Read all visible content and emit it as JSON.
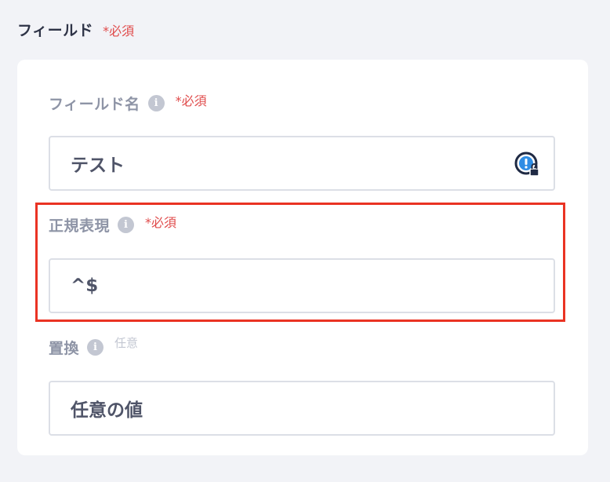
{
  "section": {
    "title": "フィールド",
    "required": "*必須"
  },
  "fields": [
    {
      "label": "フィールド名",
      "info": "i",
      "badge": "*必須",
      "value": "テスト"
    },
    {
      "label": "正規表現",
      "info": "i",
      "badge": "*必須",
      "value": "^$"
    },
    {
      "label": "置換",
      "info": "i",
      "badge": "任意",
      "value": "任意の値"
    }
  ],
  "colors": {
    "required": "#e04b4b",
    "highlight": "#ea3323",
    "background": "#f2f3f7"
  }
}
